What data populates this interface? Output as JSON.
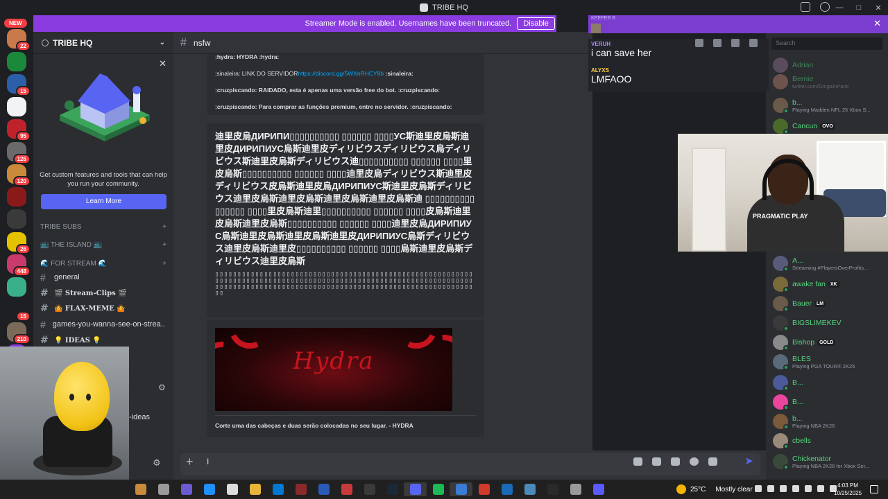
{
  "window": {
    "title": "TRIBE HQ"
  },
  "banner": {
    "text": "Streamer Mode is enabled. Usernames have been truncated.",
    "button": "Disable"
  },
  "server_rail": {
    "new_label": "NEW",
    "servers": [
      {
        "badge": "22",
        "color": "#c9794a"
      },
      {
        "badge": "",
        "color": "#1a8a3a"
      },
      {
        "badge": "15",
        "color": "#2b5fa8"
      },
      {
        "badge": "",
        "color": "#f2f3f5"
      },
      {
        "badge": "95",
        "color": "#c0222b"
      },
      {
        "badge": "126",
        "color": "#6a6a6a"
      },
      {
        "badge": "120",
        "color": "#c98a3a"
      },
      {
        "badge": "",
        "color": "#8a1a1a"
      },
      {
        "badge": "",
        "color": "#3a3a3a"
      },
      {
        "badge": "26",
        "color": "#e5c200"
      },
      {
        "badge": "448",
        "color": "#c83a6b"
      },
      {
        "badge": "",
        "color": "#3ab08a"
      },
      {
        "badge": "15",
        "color": "#1e1f22"
      },
      {
        "badge": "210",
        "color": "#7a6a5a"
      },
      {
        "badge": "",
        "color": "#8a3ce0"
      }
    ]
  },
  "sidebar": {
    "server_name": "TRIBE HQ",
    "promo_text": "Get custom features and tools that can help you run your community.",
    "promo_button": "Learn More",
    "categories": [
      {
        "label": "TRIBE SUBS"
      },
      {
        "label": "📺 THE ISLAND 📺"
      },
      {
        "label": "🌊 FOR STREAM 🌊"
      }
    ],
    "channels": [
      {
        "label": "general"
      },
      {
        "label": "🎬 Stream-Clips 🎬"
      },
      {
        "label": "🤷 FLAX-MEME 🤷"
      },
      {
        "label": "games-you-wanna-see-on-strea..."
      },
      {
        "label": "💡 IDEAS 💡"
      }
    ],
    "partial_channel": "-ideas"
  },
  "chat": {
    "channel": "nsfw",
    "embed_lines": [
      {
        "text": ":hydra: HYDRA :hydra:",
        "link": ""
      },
      {
        "text": ":sinaleira: LINK DO SERVIDOR",
        "link": "https://discord.gg/5WXnRHCY8b",
        "after": " :sinaleira:"
      },
      {
        "text": ":cruzpiscando: RAIDADO, esta é apenas uma versão free do bot. :cruzpiscando:",
        "link": ""
      },
      {
        "text": ":cruzpiscando: Para comprar as funções premium, entre no servidor. :cruzpiscando:",
        "link": ""
      }
    ],
    "spam_text": "迪里皮烏ДИРИПИ▯▯▯▯▯▯▯▯▯▯ ▯▯▯▯▯▯ ▯▯▯▯УС斯迪里皮烏斯迪里皮ДИРИПИУС烏斯迪里皮ディリビウスディリビウス烏ディリビウス斯迪里皮烏斯ディリビウス迪▯▯▯▯▯▯▯▯▯▯ ▯▯▯▯▯▯ ▯▯▯▯里皮烏斯▯▯▯▯▯▯▯▯▯▯ ▯▯▯▯▯▯ ▯▯▯▯迪里皮烏ディリビウス斯迪里皮ディリビウス皮烏斯迪里皮烏ДИРИПИУС斯迪里皮烏斯ディリビウス迪里皮烏斯迪里皮烏斯迪里皮烏斯迪里皮烏斯迪 ▯▯▯▯▯▯▯▯▯▯ ▯▯▯▯▯▯ ▯▯▯▯里皮烏斯迪里▯▯▯▯▯▯▯▯▯▯ ▯▯▯▯▯▯ ▯▯▯▯皮烏斯迪里皮烏斯迪里皮烏斯▯▯▯▯▯▯▯▯▯▯ ▯▯▯▯▯▯ ▯▯▯▯迪里皮烏ДИРИПИУС烏斯迪里皮烏斯迪里皮烏斯迪里皮ДИРИПИУС烏斯ディリビウス迪里皮烏斯迪里皮▯▯▯▯▯▯▯▯▯▯ ▯▯▯▯▯▯ ▯▯▯▯烏斯迪里皮烏斯ディリビウス迪里皮烏斯",
    "dots_text": "▯▯▯▯▯▯▯▯▯▯▯▯▯▯▯▯▯▯▯▯▯▯▯▯▯▯▯▯▯▯▯▯▯▯▯▯▯▯▯▯▯▯▯▯▯▯▯▯▯▯▯▯▯▯▯▯▯▯▯▯▯▯▯▯▯▯▯▯▯▯▯▯▯▯▯▯▯▯▯▯▯▯▯▯▯▯▯▯▯▯▯▯▯▯▯▯▯▯▯▯▯▯▯▯▯▯▯▯▯▯▯▯▯▯▯▯▯▯▯▯▯▯▯▯▯▯▯▯▯▯▯▯▯▯▯▯▯▯▯▯▯▯▯▯▯▯▯▯▯▯▯▯▯▯▯▯▯▯▯▯▯▯▯▯▯▯▯▯▯▯▯▯▯▯▯▯",
    "image_word": "Hydra",
    "image_caption": "Corte uma das cabeças e duas serão colocadas no seu lugar. - HYDRA"
  },
  "overlay_chat": {
    "top_name": "KEEPER B",
    "messages": [
      {
        "user": "VERUH",
        "text": "i can save her",
        "color": "#b38bff"
      },
      {
        "user": "ALYXS",
        "text": "LMFAOO",
        "color": "#ffd24a"
      }
    ]
  },
  "members": {
    "search_placeholder": "Search",
    "list": [
      {
        "name": "Adrian",
        "activity": "",
        "tag": "",
        "dim": true,
        "color": "#8a6a8a"
      },
      {
        "name": "Bernie",
        "activity": "twitter.com/GingaInParis",
        "tag": "",
        "dim": true,
        "color": "#b07a6a"
      },
      {
        "name": "b...",
        "activity": "Playing Madden NFL 25 Xbox S...",
        "tag": "",
        "dim": false,
        "color": "#6a5a4a"
      },
      {
        "name": "Cancun",
        "activity": "",
        "tag": "OVO",
        "dim": false,
        "color": "#4a6a2a"
      },
      {
        "name": "A...",
        "activity": "Streaming #PlayersOverProfits...",
        "tag": "",
        "dim": false,
        "color": "#5a5a7a"
      },
      {
        "name": "awake fan",
        "activity": "",
        "tag": "XK",
        "dim": false,
        "color": "#7a6a3a"
      },
      {
        "name": "Bauer",
        "activity": "",
        "tag": "LM",
        "dim": false,
        "color": "#6a5a4a"
      },
      {
        "name": "BIGSLIMEKEV",
        "activity": "",
        "tag": "",
        "dim": false,
        "color": "#3a3a3a"
      },
      {
        "name": "Bishop",
        "activity": "",
        "tag": "GOLD",
        "dim": false,
        "color": "#8a8a8a"
      },
      {
        "name": "BLES",
        "activity": "Playing PGA TOUR® 2K25",
        "tag": "",
        "dim": false,
        "color": "#5a6a7a"
      },
      {
        "name": "B...",
        "activity": "",
        "tag": "",
        "dim": false,
        "color": "#4a5a9a"
      },
      {
        "name": "B...",
        "activity": "",
        "tag": "",
        "dim": false,
        "color": "#eb459e"
      },
      {
        "name": "b...",
        "activity": "Playing NBA 2K26",
        "tag": "",
        "dim": false,
        "color": "#7a5a3a"
      },
      {
        "name": "cbells",
        "activity": "",
        "tag": "",
        "dim": false,
        "color": "#9a8a7a"
      },
      {
        "name": "Chickenator",
        "activity": "Playing NBA 2K26 for Xbox Ser...",
        "tag": "",
        "dim": false,
        "color": "#3a4a3a"
      }
    ]
  },
  "webcam": {
    "brand_text": "PRAGMATIC PLAY"
  },
  "composer": {
    "placeholder": "I"
  },
  "taskbar": {
    "weather": "25°C",
    "weather_desc": "Mostly clear",
    "time": "4:03 PM",
    "date": "10/25/2025",
    "apps": [
      {
        "color": "#c98a3a"
      },
      {
        "color": "#9a9a9a"
      },
      {
        "color": "#6b5bd2"
      },
      {
        "color": "#1e90ff"
      },
      {
        "color": "#dcdcdc"
      },
      {
        "color": "#e8b43a"
      },
      {
        "color": "#0078d4"
      },
      {
        "color": "#8a2a2a"
      },
      {
        "color": "#2a5ab8"
      },
      {
        "color": "#c83a3a"
      },
      {
        "color": "#3a3a3a"
      },
      {
        "color": "#1b2838"
      },
      {
        "color": "#5865f2"
      },
      {
        "color": "#1db954"
      },
      {
        "color": "#3a7bd5"
      },
      {
        "color": "#d03a2a"
      },
      {
        "color": "#1a6ab8"
      },
      {
        "color": "#4a8ab8"
      },
      {
        "color": "#2a2a2a"
      },
      {
        "color": "#9a9a9a"
      },
      {
        "color": "#5a5aff"
      }
    ]
  }
}
